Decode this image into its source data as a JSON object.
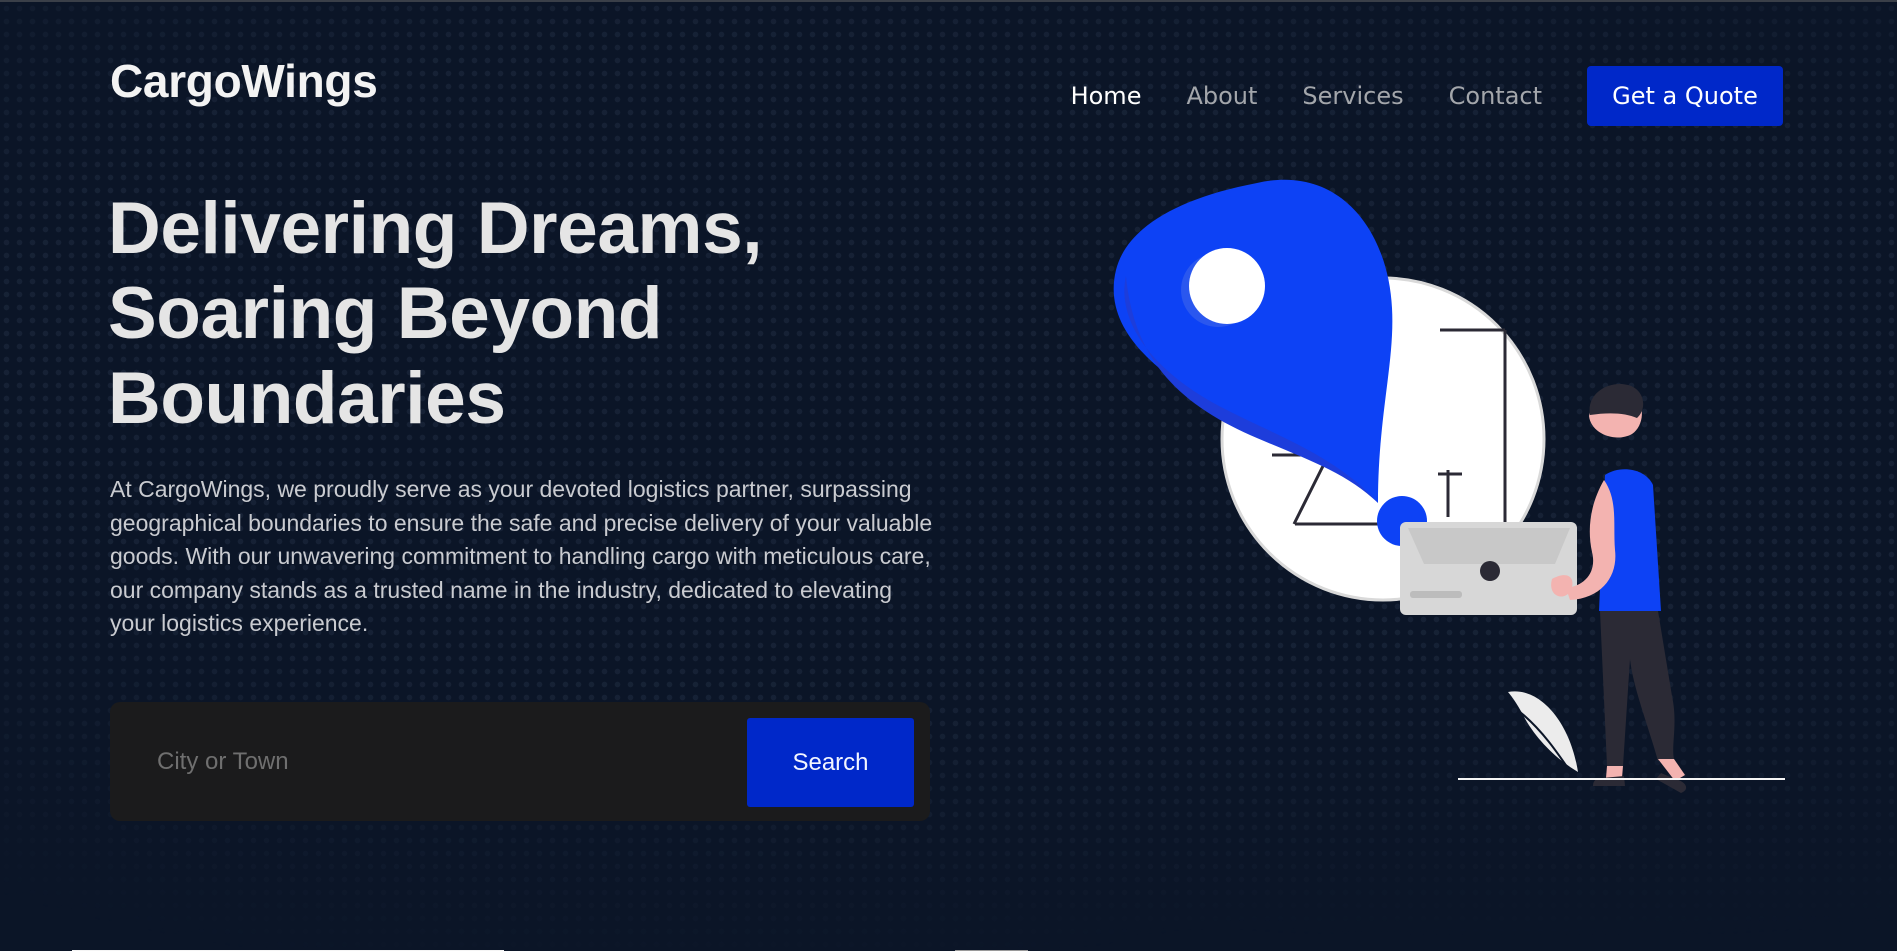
{
  "brand": {
    "name": "CargoWings"
  },
  "nav": {
    "items": [
      {
        "label": "Home"
      },
      {
        "label": "About"
      },
      {
        "label": "Services"
      },
      {
        "label": "Contact"
      }
    ],
    "cta_label": "Get a Quote"
  },
  "hero": {
    "title_lines": [
      "Delivering Dreams,",
      "Soaring Beyond",
      "Boundaries"
    ],
    "description": "At CargoWings, we proudly serve as your devoted logistics partner, surpassing geographical boundaries to ensure the safe and precise delivery of your valuable goods. With our unwavering commitment to handling cargo with meticulous care, our company stands as a trusted name in the industry, dedicated to elevating your logistics experience."
  },
  "search": {
    "placeholder": "City or Town",
    "button_label": "Search"
  },
  "illustration": {
    "primary_color": "#0d42f5",
    "accent_dark": "#2b2a35",
    "surface_white": "#ffffff"
  },
  "colors": {
    "background": "#0b1527",
    "button": "#0028c9"
  }
}
